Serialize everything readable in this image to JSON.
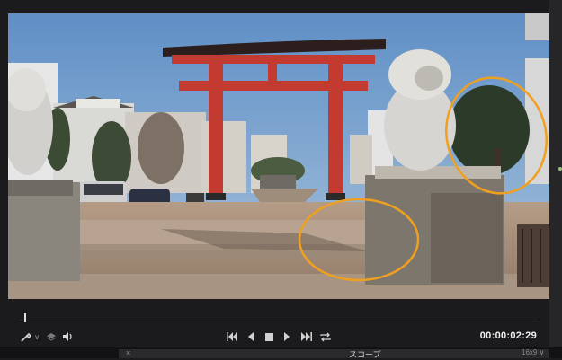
{
  "viewer": {
    "scene": "torii-gate-shrine-approach",
    "annotation_color": "#f0a020"
  },
  "transport": {
    "timecode": "00:00:02:29",
    "progress": 0.01
  },
  "bottom_panel": {
    "close_symbol": "×",
    "title": "スコープ",
    "ratio": "16x9 ∨"
  },
  "icons": {
    "eyedropper": "eyedropper-icon",
    "layers": "layers-icon",
    "volume": "volume-icon",
    "first": "skip-to-start-icon",
    "prev": "step-back-icon",
    "stop": "stop-icon",
    "play": "play-icon",
    "last": "skip-to-end-icon",
    "loop": "loop-icon"
  }
}
